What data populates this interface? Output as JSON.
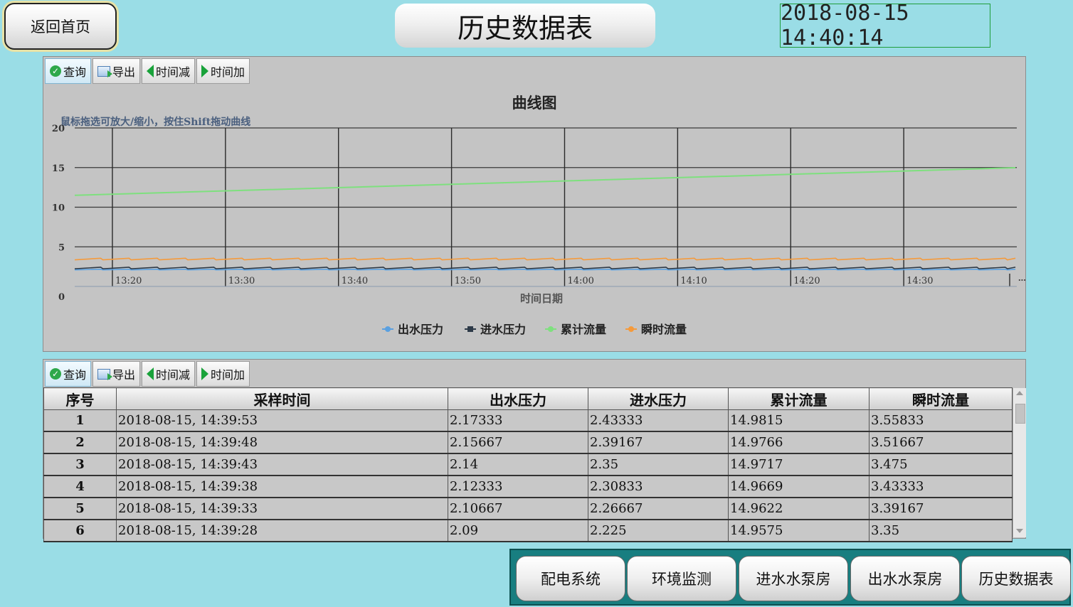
{
  "header": {
    "home_label": "返回首页",
    "title": "历史数据表",
    "datetime": "2018-08-15 14:40:14"
  },
  "toolbar": {
    "query": "查询",
    "export": "导出",
    "time_minus": "时间减",
    "time_plus": "时间加"
  },
  "chart_data": {
    "type": "line",
    "title": "曲线图",
    "subtitle": "鼠标拖选可放大/缩小，按住Shift拖动曲线",
    "xlabel": "时间日期",
    "ylabel": "",
    "ylim": [
      0,
      20
    ],
    "y_ticks": [
      0,
      5,
      10,
      15,
      20
    ],
    "x_ticks": [
      "13:20",
      "13:30",
      "13:40",
      "13:50",
      "14:00",
      "14:10",
      "14:20",
      "14:30"
    ],
    "x_range": [
      "13:16:40",
      "14:40:00"
    ],
    "legend_placement": "bottom",
    "grid": true,
    "series": [
      {
        "name": "出水压力",
        "color": "#5aa0e0",
        "pattern": "sawtooth",
        "low": 2.09,
        "high": 2.17,
        "period_min": 2.5
      },
      {
        "name": "进水压力",
        "color": "#2d3a48",
        "pattern": "sawtooth",
        "low": 2.22,
        "high": 2.43,
        "period_min": 2.5
      },
      {
        "name": "累计流量",
        "color": "#7ee07e",
        "pattern": "linear",
        "x": [
          "13:16:40",
          "14:39:53"
        ],
        "y": [
          11.5,
          14.98
        ]
      },
      {
        "name": "瞬时流量",
        "color": "#f59a3b",
        "pattern": "sawtooth",
        "low": 3.35,
        "high": 3.56,
        "period_min": 2.5
      }
    ]
  },
  "table": {
    "columns": [
      "序号",
      "采样时间",
      "出水压力",
      "进水压力",
      "累计流量",
      "瞬时流量"
    ],
    "rows": [
      [
        "1",
        "2018-08-15, 14:39:53",
        "2.17333",
        "2.43333",
        "14.9815",
        "3.55833"
      ],
      [
        "2",
        "2018-08-15, 14:39:48",
        "2.15667",
        "2.39167",
        "14.9766",
        "3.51667"
      ],
      [
        "3",
        "2018-08-15, 14:39:43",
        "2.14",
        "2.35",
        "14.9717",
        "3.475"
      ],
      [
        "4",
        "2018-08-15, 14:39:38",
        "2.12333",
        "2.30833",
        "14.9669",
        "3.43333"
      ],
      [
        "5",
        "2018-08-15, 14:39:33",
        "2.10667",
        "2.26667",
        "14.9622",
        "3.39167"
      ],
      [
        "6",
        "2018-08-15, 14:39:28",
        "2.09",
        "2.225",
        "14.9575",
        "3.35"
      ]
    ]
  },
  "nav": {
    "items": [
      "配电系统",
      "环境监测",
      "进水水泵房",
      "出水水泵房",
      "历史数据表"
    ]
  }
}
